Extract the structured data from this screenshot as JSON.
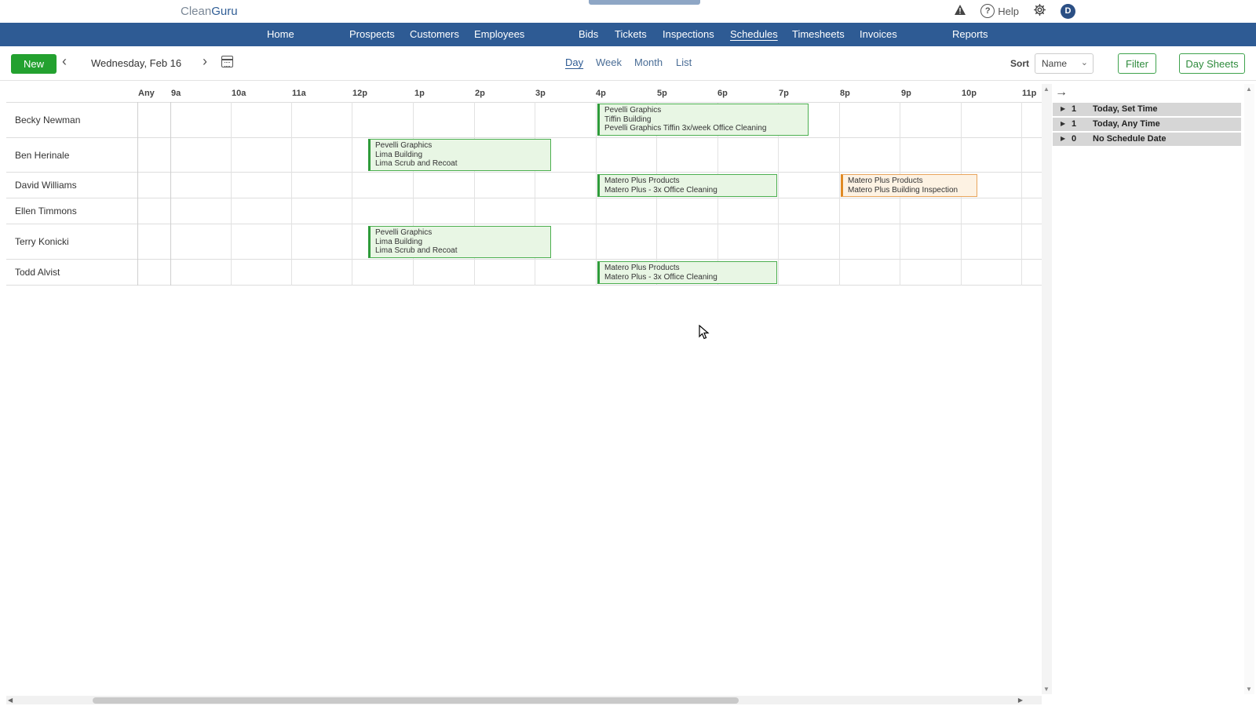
{
  "app": {
    "logo_part1": "Clean",
    "logo_part2": "Guru"
  },
  "header": {
    "help_label": "Help",
    "avatar_initial": "D"
  },
  "nav": {
    "items": [
      "Home",
      "Prospects",
      "Customers",
      "Employees",
      "Bids",
      "Tickets",
      "Inspections",
      "Schedules",
      "Timesheets",
      "Invoices",
      "Reports"
    ],
    "active": "Schedules"
  },
  "toolbar": {
    "new_label": "New",
    "date": "Wednesday, Feb 16",
    "views": [
      "Day",
      "Week",
      "Month",
      "List"
    ],
    "active_view": "Day",
    "sort_label": "Sort",
    "sort_value": "Name",
    "filter_label": "Filter",
    "day_sheets_label": "Day Sheets"
  },
  "grid": {
    "hours": [
      "Any",
      "9a",
      "10a",
      "11a",
      "12p",
      "1p",
      "2p",
      "3p",
      "4p",
      "5p",
      "6p",
      "7p",
      "8p",
      "9p",
      "10p",
      "11p"
    ],
    "employees": [
      "Becky Newman",
      "Ben Herinale",
      "David Williams",
      "Ellen Timmons",
      "Terry Konicki",
      "Todd Alvist"
    ]
  },
  "events": [
    {
      "employee": "Becky Newman",
      "lines": [
        "Pevelli Graphics",
        "Tiffin Building",
        "Pevelli Graphics Tiffin 3x/week Office Cleaning"
      ],
      "status": "scheduled"
    },
    {
      "employee": "Ben Herinale",
      "lines": [
        "Pevelli Graphics",
        "Lima Building",
        "Lima Scrub and Recoat"
      ],
      "status": "scheduled"
    },
    {
      "employee": "David Williams",
      "lines": [
        "Matero Plus Products",
        "Matero Plus - 3x Office Cleaning"
      ],
      "status": "scheduled"
    },
    {
      "employee": "David Williams",
      "lines": [
        "Matero Plus Products",
        "Matero Plus Building Inspection"
      ],
      "status": "inspection"
    },
    {
      "employee": "Terry Konicki",
      "lines": [
        "Pevelli Graphics",
        "Lima Building",
        "Lima Scrub and Recoat"
      ],
      "status": "scheduled"
    },
    {
      "employee": "Todd Alvist",
      "lines": [
        "Matero Plus Products",
        "Matero Plus - 3x Office Cleaning"
      ],
      "status": "scheduled"
    }
  ],
  "unscheduled": [
    {
      "count": "1",
      "label": "Today, Set Time"
    },
    {
      "count": "1",
      "label": "Today, Any Time"
    },
    {
      "count": "0",
      "label": "No Schedule Date"
    }
  ],
  "colors": {
    "nav": "#2e5b94",
    "new_button": "#23a12f",
    "event_green": "#e8f6e4",
    "event_orange": "#fdf2e3"
  }
}
